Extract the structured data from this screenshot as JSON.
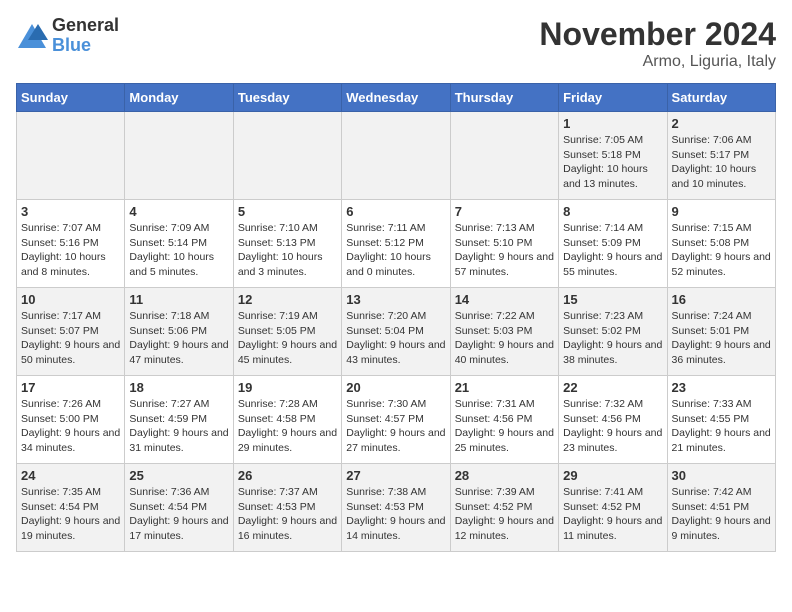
{
  "logo": {
    "general": "General",
    "blue": "Blue"
  },
  "header": {
    "month": "November 2024",
    "location": "Armo, Liguria, Italy"
  },
  "days_of_week": [
    "Sunday",
    "Monday",
    "Tuesday",
    "Wednesday",
    "Thursday",
    "Friday",
    "Saturday"
  ],
  "weeks": [
    [
      {
        "day": "",
        "info": ""
      },
      {
        "day": "",
        "info": ""
      },
      {
        "day": "",
        "info": ""
      },
      {
        "day": "",
        "info": ""
      },
      {
        "day": "",
        "info": ""
      },
      {
        "day": "1",
        "info": "Sunrise: 7:05 AM\nSunset: 5:18 PM\nDaylight: 10 hours and 13 minutes."
      },
      {
        "day": "2",
        "info": "Sunrise: 7:06 AM\nSunset: 5:17 PM\nDaylight: 10 hours and 10 minutes."
      }
    ],
    [
      {
        "day": "3",
        "info": "Sunrise: 7:07 AM\nSunset: 5:16 PM\nDaylight: 10 hours and 8 minutes."
      },
      {
        "day": "4",
        "info": "Sunrise: 7:09 AM\nSunset: 5:14 PM\nDaylight: 10 hours and 5 minutes."
      },
      {
        "day": "5",
        "info": "Sunrise: 7:10 AM\nSunset: 5:13 PM\nDaylight: 10 hours and 3 minutes."
      },
      {
        "day": "6",
        "info": "Sunrise: 7:11 AM\nSunset: 5:12 PM\nDaylight: 10 hours and 0 minutes."
      },
      {
        "day": "7",
        "info": "Sunrise: 7:13 AM\nSunset: 5:10 PM\nDaylight: 9 hours and 57 minutes."
      },
      {
        "day": "8",
        "info": "Sunrise: 7:14 AM\nSunset: 5:09 PM\nDaylight: 9 hours and 55 minutes."
      },
      {
        "day": "9",
        "info": "Sunrise: 7:15 AM\nSunset: 5:08 PM\nDaylight: 9 hours and 52 minutes."
      }
    ],
    [
      {
        "day": "10",
        "info": "Sunrise: 7:17 AM\nSunset: 5:07 PM\nDaylight: 9 hours and 50 minutes."
      },
      {
        "day": "11",
        "info": "Sunrise: 7:18 AM\nSunset: 5:06 PM\nDaylight: 9 hours and 47 minutes."
      },
      {
        "day": "12",
        "info": "Sunrise: 7:19 AM\nSunset: 5:05 PM\nDaylight: 9 hours and 45 minutes."
      },
      {
        "day": "13",
        "info": "Sunrise: 7:20 AM\nSunset: 5:04 PM\nDaylight: 9 hours and 43 minutes."
      },
      {
        "day": "14",
        "info": "Sunrise: 7:22 AM\nSunset: 5:03 PM\nDaylight: 9 hours and 40 minutes."
      },
      {
        "day": "15",
        "info": "Sunrise: 7:23 AM\nSunset: 5:02 PM\nDaylight: 9 hours and 38 minutes."
      },
      {
        "day": "16",
        "info": "Sunrise: 7:24 AM\nSunset: 5:01 PM\nDaylight: 9 hours and 36 minutes."
      }
    ],
    [
      {
        "day": "17",
        "info": "Sunrise: 7:26 AM\nSunset: 5:00 PM\nDaylight: 9 hours and 34 minutes."
      },
      {
        "day": "18",
        "info": "Sunrise: 7:27 AM\nSunset: 4:59 PM\nDaylight: 9 hours and 31 minutes."
      },
      {
        "day": "19",
        "info": "Sunrise: 7:28 AM\nSunset: 4:58 PM\nDaylight: 9 hours and 29 minutes."
      },
      {
        "day": "20",
        "info": "Sunrise: 7:30 AM\nSunset: 4:57 PM\nDaylight: 9 hours and 27 minutes."
      },
      {
        "day": "21",
        "info": "Sunrise: 7:31 AM\nSunset: 4:56 PM\nDaylight: 9 hours and 25 minutes."
      },
      {
        "day": "22",
        "info": "Sunrise: 7:32 AM\nSunset: 4:56 PM\nDaylight: 9 hours and 23 minutes."
      },
      {
        "day": "23",
        "info": "Sunrise: 7:33 AM\nSunset: 4:55 PM\nDaylight: 9 hours and 21 minutes."
      }
    ],
    [
      {
        "day": "24",
        "info": "Sunrise: 7:35 AM\nSunset: 4:54 PM\nDaylight: 9 hours and 19 minutes."
      },
      {
        "day": "25",
        "info": "Sunrise: 7:36 AM\nSunset: 4:54 PM\nDaylight: 9 hours and 17 minutes."
      },
      {
        "day": "26",
        "info": "Sunrise: 7:37 AM\nSunset: 4:53 PM\nDaylight: 9 hours and 16 minutes."
      },
      {
        "day": "27",
        "info": "Sunrise: 7:38 AM\nSunset: 4:53 PM\nDaylight: 9 hours and 14 minutes."
      },
      {
        "day": "28",
        "info": "Sunrise: 7:39 AM\nSunset: 4:52 PM\nDaylight: 9 hours and 12 minutes."
      },
      {
        "day": "29",
        "info": "Sunrise: 7:41 AM\nSunset: 4:52 PM\nDaylight: 9 hours and 11 minutes."
      },
      {
        "day": "30",
        "info": "Sunrise: 7:42 AM\nSunset: 4:51 PM\nDaylight: 9 hours and 9 minutes."
      }
    ]
  ]
}
